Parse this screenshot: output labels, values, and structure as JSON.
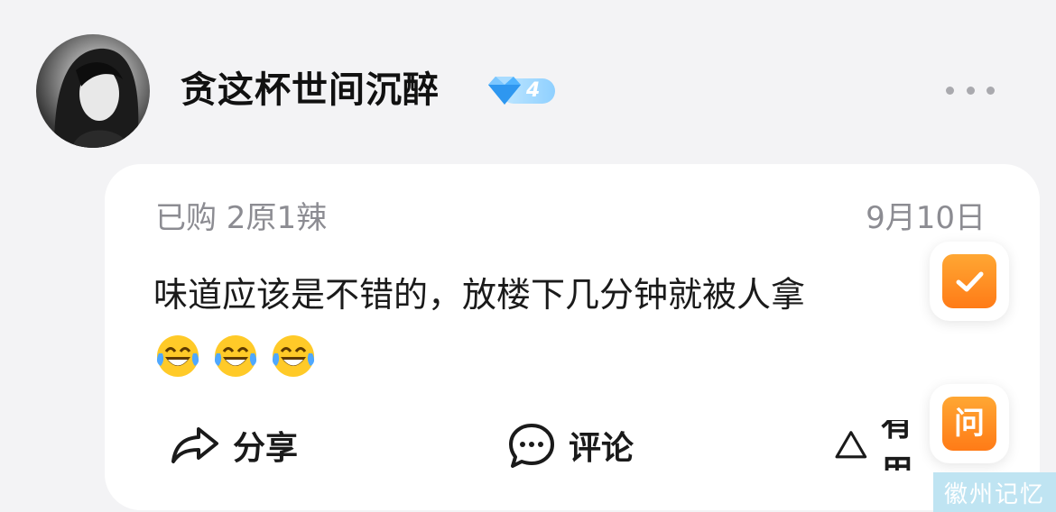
{
  "user": {
    "name": "贪这杯世间沉醉",
    "level": "4",
    "level_color": "#7fc8ff"
  },
  "review": {
    "meta": "已购 2原1辣",
    "date": "9月10日",
    "text": "味道应该是不错的，放楼下几分钟就被人拿",
    "emojis": [
      "laugh-cry-emoji",
      "laugh-cry-emoji",
      "laugh-cry-emoji"
    ]
  },
  "actions": {
    "share_label": "分享",
    "comment_label": "评论",
    "useful_label": "有用"
  },
  "floating": {
    "ask_label": "问",
    "accent_color": "#ff8a1f"
  },
  "watermark": "徽州记忆"
}
